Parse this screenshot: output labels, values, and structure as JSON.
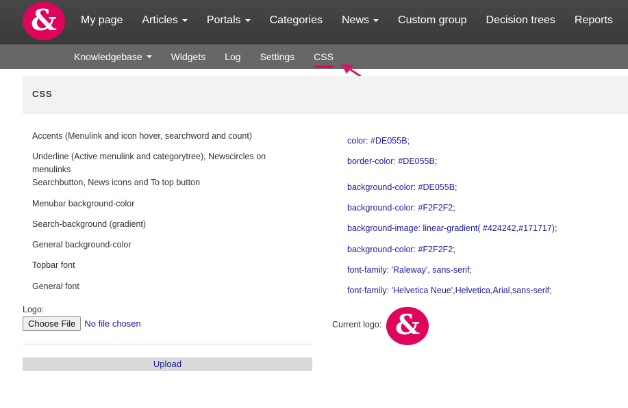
{
  "colors": {
    "accent": "#DE055B",
    "topbar": "#424242",
    "subbar": "#676767",
    "panel": "#F2F2F2",
    "link": "#1A1AA0"
  },
  "brand": {
    "logo_glyph": "&"
  },
  "topnav": {
    "items": [
      {
        "label": "My page"
      },
      {
        "label": "Articles"
      },
      {
        "label": "Portals"
      },
      {
        "label": "Categories"
      },
      {
        "label": "News"
      },
      {
        "label": "Custom group"
      },
      {
        "label": "Decision trees"
      },
      {
        "label": "Reports"
      }
    ]
  },
  "subnav": {
    "items": [
      {
        "label": "Knowledgebase"
      },
      {
        "label": "Widgets"
      },
      {
        "label": "Log"
      },
      {
        "label": "Settings"
      },
      {
        "label": "CSS"
      }
    ],
    "active": "CSS"
  },
  "panel": {
    "title": "CSS"
  },
  "settings": {
    "labels": [
      "Accents (Menulink and icon hover, searchword and count)",
      "Underline (Active menulink and categorytree), Newscircles on",
      "menulinks",
      "Searchbutton, News icons and To top button",
      "Menubar background-color",
      "Search-background (gradient)",
      "General background-color",
      "Topbar font",
      "General font"
    ],
    "values": [
      "color: #DE055B;",
      "border-color: #DE055B;",
      "background-color: #DE055B;",
      "background-color: #F2F2F2;",
      "background-image: linear-gradient( #424242,#171717);",
      "background-color: #F2F2F2;",
      "font-family: 'Raleway', sans-serif;",
      "font-family: 'Helvetica Neue',Helvetica,Arial,sans-serif;"
    ]
  },
  "logo_upload": {
    "label": "Logo:",
    "choose_button": "Choose File",
    "status": "No file chosen",
    "upload_button": "Upload",
    "current_label": "Current logo:"
  }
}
